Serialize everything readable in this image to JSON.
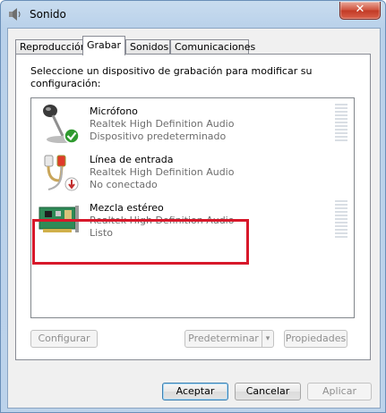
{
  "window": {
    "title": "Sonido",
    "close_label": "✕"
  },
  "tabs": [
    {
      "label": "Reproducción"
    },
    {
      "label": "Grabar"
    },
    {
      "label": "Sonidos"
    },
    {
      "label": "Comunicaciones"
    }
  ],
  "panel": {
    "instructions": "Seleccione un dispositivo de grabación para modificar su configuración:"
  },
  "devices": [
    {
      "name": "Micrófono",
      "driver": "Realtek High Definition Audio",
      "status": "Dispositivo predeterminado",
      "icon": "microphone-icon",
      "badge": "check-badge-icon"
    },
    {
      "name": "Línea de entrada",
      "driver": "Realtek High Definition Audio",
      "status": "No conectado",
      "icon": "audio-jack-icon",
      "badge": "unplugged-badge-icon"
    },
    {
      "name": "Mezcla estéreo",
      "driver": "Realtek High Definition Audio",
      "status": "Listo",
      "icon": "sound-card-icon"
    }
  ],
  "panel_buttons": {
    "configure": "Configurar",
    "set_default": "Predeterminar",
    "split_arrow": "▾",
    "properties": "Propiedades"
  },
  "dialog_buttons": {
    "accept": "Aceptar",
    "cancel": "Cancelar",
    "apply": "Aplicar"
  },
  "colors": {
    "highlight": "#d7182a",
    "default_check": "#2f9a2f",
    "unplugged": "#c23030"
  }
}
